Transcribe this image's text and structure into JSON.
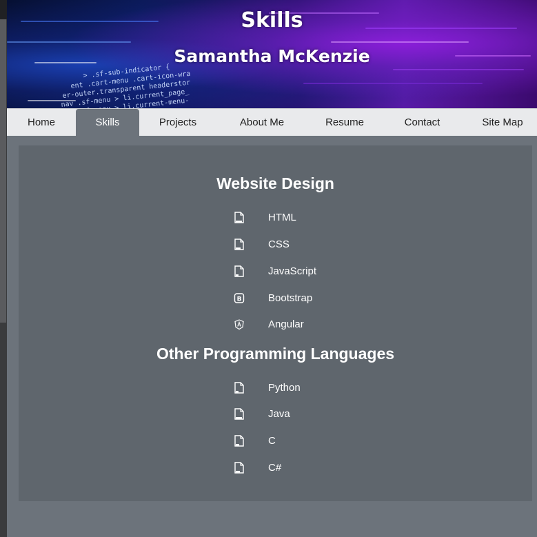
{
  "header": {
    "title": "Skills",
    "subtitle": "Samantha McKenzie",
    "code_lines": [
      "> .sf-sub-indicator {",
      "ent .cart-menu .cart-icon-wra",
      "er-outer.transparent headerstor",
      "nav .sf-menu > li.current_page_",
      "nav .sf-menu > li.current-menu-"
    ]
  },
  "nav": {
    "items": [
      {
        "label": "Home"
      },
      {
        "label": "Skills",
        "active": true
      },
      {
        "label": "Projects"
      },
      {
        "label": "About Me"
      },
      {
        "label": "Resume"
      },
      {
        "label": "Contact"
      },
      {
        "label": "Site Map"
      }
    ]
  },
  "sections": [
    {
      "title": "Website Design",
      "skills": [
        {
          "label": "HTML",
          "icon": "html-file-icon"
        },
        {
          "label": "CSS",
          "icon": "css-file-icon"
        },
        {
          "label": "JavaScript",
          "icon": "js-file-icon"
        },
        {
          "label": "Bootstrap",
          "icon": "bootstrap-icon"
        },
        {
          "label": "Angular",
          "icon": "angular-icon"
        }
      ]
    },
    {
      "title": "Other Programming Languages",
      "skills": [
        {
          "label": "Python",
          "icon": "python-file-icon"
        },
        {
          "label": "Java",
          "icon": "java-file-icon"
        },
        {
          "label": "C",
          "icon": "c-file-icon"
        },
        {
          "label": "C#",
          "icon": "csharp-file-icon"
        }
      ]
    }
  ],
  "colors": {
    "page_bg": "#6c737b",
    "card_bg": "#5f666d",
    "nav_bg": "#e9eaec",
    "text": "#ffffff"
  }
}
